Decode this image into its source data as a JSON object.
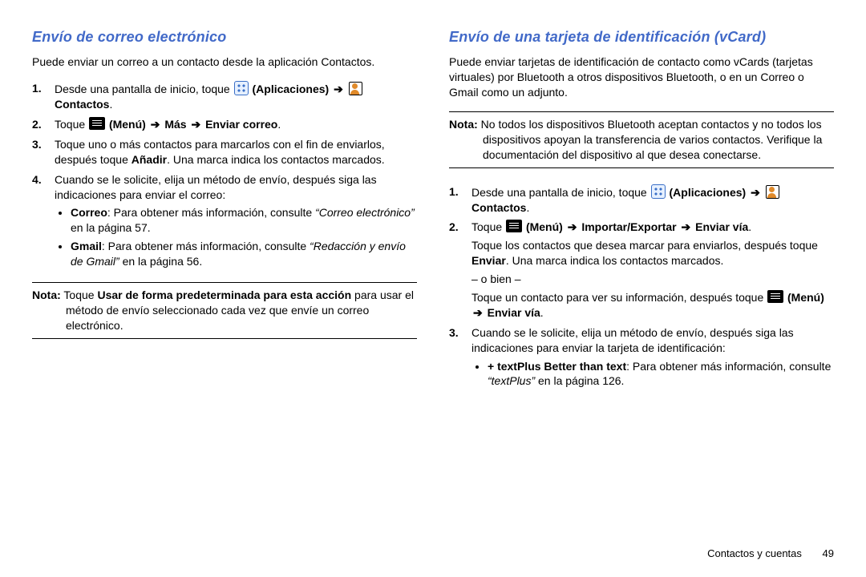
{
  "left": {
    "heading": "Envío de correo electrónico",
    "intro": "Puede enviar un correo a un contacto desde la aplicación Contactos.",
    "steps": {
      "s1n": "1.",
      "s1a": "Desde una pantalla de inicio, toque ",
      "s1apps": "(Aplicaciones)",
      "s1arrow": "➔",
      "s1contacts": "Contactos",
      "s1period": ".",
      "s2n": "2.",
      "s2a": "Toque ",
      "s2menu": "(Menú)",
      "s2arrow1": "➔",
      "s2mas": "Más",
      "s2arrow2": "➔",
      "s2enviar": "Enviar correo",
      "s2period": ".",
      "s3n": "3.",
      "s3a": "Toque uno o más contactos para marcarlos con el fin de enviarlos, después toque ",
      "s3anadir": "Añadir",
      "s3b": ". Una marca indica los contactos marcados.",
      "s4n": "4.",
      "s4": "Cuando se le solicite, elija un método de envío, después siga las indicaciones para enviar el correo:",
      "b1label": "Correo",
      "b1a": ": Para obtener más información, consulte ",
      "b1ref": "“Correo electrónico”",
      "b1b": " en la página 57.",
      "b2label": "Gmail",
      "b2a": ": Para obtener más información, consulte ",
      "b2ref": "“Redacción y envío de Gmail”",
      "b2b": " en la página 56."
    },
    "note": {
      "label": "Nota:",
      "a": " Toque ",
      "bold": "Usar de forma predeterminada para esta acción",
      "b": " para usar el método de envío seleccionado cada vez que envíe un correo electrónico."
    }
  },
  "right": {
    "heading": "Envío de una tarjeta de identificación (vCard)",
    "intro": "Puede enviar tarjetas de identificación de contacto como vCards (tarjetas virtuales) por Bluetooth a otros dispositivos Bluetooth, o en un Correo o Gmail como un adjunto.",
    "note1": {
      "label": "Nota:",
      "body": " No todos los dispositivos Bluetooth aceptan contactos y no todos los dispositivos apoyan la transferencia de varios contactos. Verifique la documentación del dispositivo al que desea conectarse."
    },
    "steps": {
      "s1n": "1.",
      "s1a": "Desde una pantalla de inicio, toque ",
      "s1apps": "(Aplicaciones)",
      "s1arrow": "➔",
      "s1contacts": "Contactos",
      "s1period": ".",
      "s2n": "2.",
      "s2a": "Toque ",
      "s2menu": "(Menú)",
      "s2arrow1": "➔",
      "s2impexp": "Importar/Exportar",
      "s2arrow2": "➔",
      "s2enviar": "Enviar vía",
      "s2period": ".",
      "s2b": "Toque los contactos que desea marcar para enviarlos, después toque ",
      "s2enviarbtn": "Enviar",
      "s2c": ". Una marca indica los contactos marcados.",
      "or": "– o bien –",
      "s2d": "Toque un contacto para ver su información, después toque ",
      "s2menu2": "(Menú)",
      "s2arrow3": "➔",
      "s2enviar2": "Enviar vía",
      "s2period2": ".",
      "s3n": "3.",
      "s3": "Cuando se le solicite, elija un método de envío, después siga las indicaciones para enviar la tarjeta de identificación:",
      "b1label": "+ textPlus Better than text",
      "b1a": ": Para obtener más información, consulte ",
      "b1ref": "“textPlus”",
      "b1b": " en la página 126."
    }
  },
  "footer": {
    "section": "Contactos y cuentas",
    "page": "49"
  }
}
